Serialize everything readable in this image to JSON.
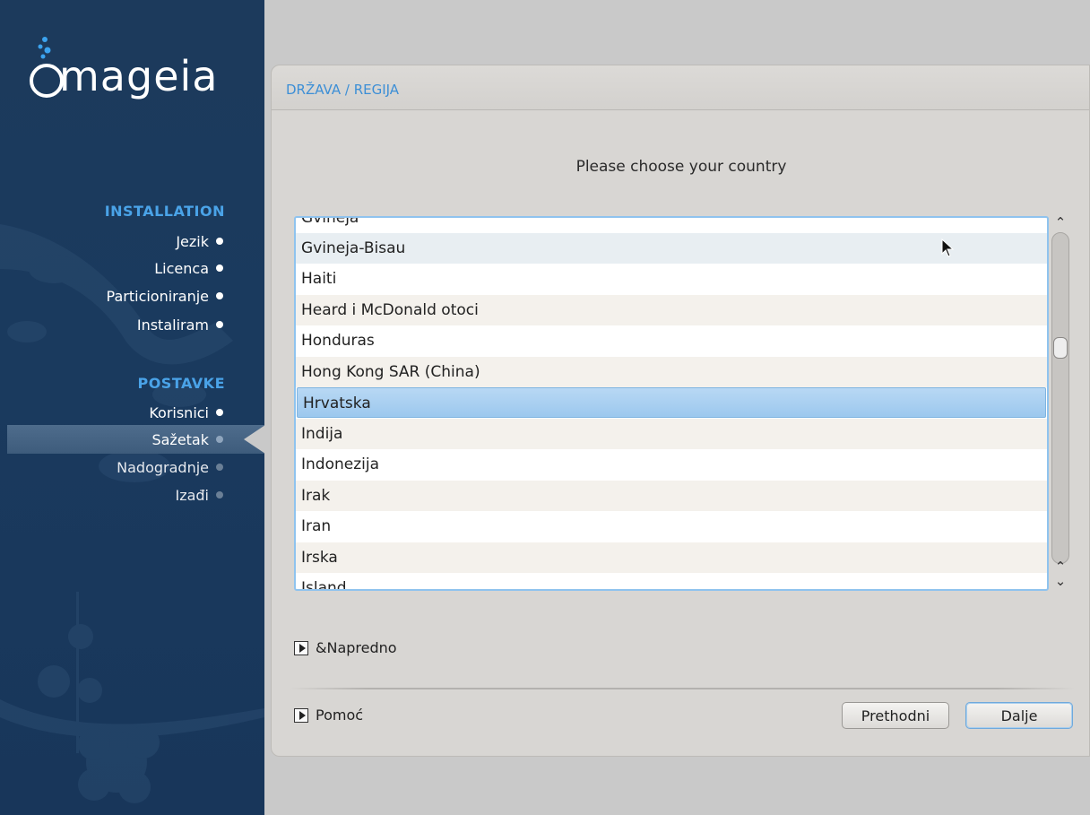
{
  "sidebar": {
    "logo_text": "mageia",
    "sections": [
      {
        "title": "INSTALLATION",
        "steps": [
          {
            "label": "Jezik",
            "state": "done"
          },
          {
            "label": "Licenca",
            "state": "done"
          },
          {
            "label": "Particioniranje",
            "state": "done"
          },
          {
            "label": "Instaliram",
            "state": "done"
          }
        ]
      },
      {
        "title": "POSTAVKE",
        "steps": [
          {
            "label": "Korisnici",
            "state": "done"
          },
          {
            "label": "Sažetak",
            "state": "current"
          },
          {
            "label": "Nadogradnje",
            "state": "pending"
          },
          {
            "label": "Izađi",
            "state": "pending"
          }
        ]
      }
    ]
  },
  "panel": {
    "title": "DRŽAVA / REGIJA",
    "prompt": "Please choose your country",
    "countries": [
      "Gvineja",
      "Gvineja-Bisau",
      "Haiti",
      "Heard i McDonald otoci",
      "Honduras",
      "Hong Kong SAR (China)",
      "Hrvatska",
      "Indija",
      "Indonezija",
      "Irak",
      "Iran",
      "Irska",
      "Island"
    ],
    "selected_country": "Hrvatska",
    "advanced_label": "&Napredno",
    "help_label": "Pomoć",
    "prev_button": "Prethodni",
    "next_button": "Dalje"
  },
  "colors": {
    "sidebar_bg": "#1c3a5c",
    "section_title": "#4aa3e8",
    "panel_title": "#3d8fd6",
    "selection": "#9cc8ee"
  }
}
